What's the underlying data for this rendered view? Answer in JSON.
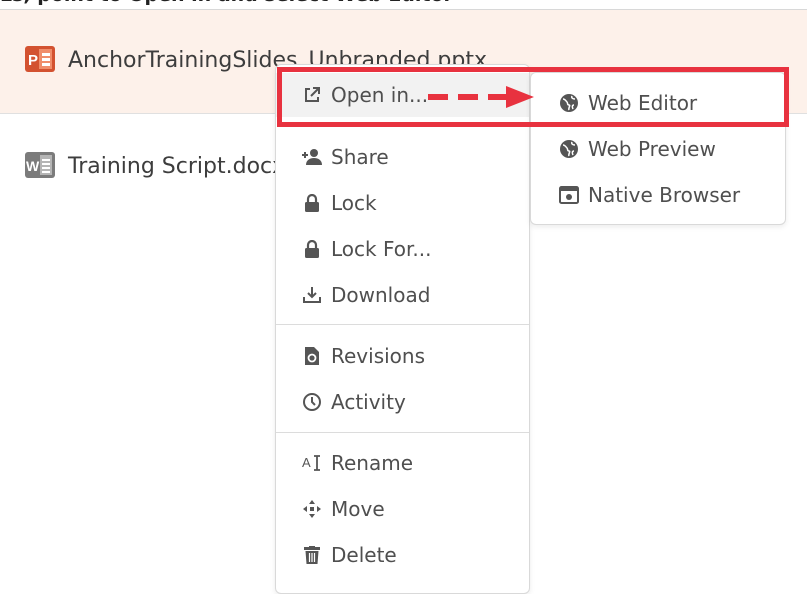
{
  "caption": "Ls, point to Open in and select Web Editor",
  "files": [
    {
      "name": "AnchorTrainingSlides_Unbranded.pptx",
      "icon": "powerpoint-icon",
      "icon_color": "#d35230",
      "selected": true
    },
    {
      "name": "Training Script.docx",
      "icon": "word-icon",
      "icon_color": "#7b7b7b",
      "selected": false
    }
  ],
  "context_menu": {
    "open_in": {
      "label": "Open in...",
      "icon": "external-link-icon"
    },
    "share": {
      "label": "Share",
      "icon": "add-user-icon"
    },
    "lock": {
      "label": "Lock",
      "icon": "lock-icon"
    },
    "lock_for": {
      "label": "Lock For...",
      "icon": "lock-icon"
    },
    "download": {
      "label": "Download",
      "icon": "download-icon"
    },
    "revisions": {
      "label": "Revisions",
      "icon": "file-revision-icon"
    },
    "activity": {
      "label": "Activity",
      "icon": "clock-icon"
    },
    "rename": {
      "label": "Rename",
      "icon": "rename-icon"
    },
    "move": {
      "label": "Move",
      "icon": "move-arrows-icon"
    },
    "delete": {
      "label": "Delete",
      "icon": "trash-icon"
    }
  },
  "submenu": {
    "web_editor": {
      "label": "Web Editor",
      "icon": "globe-icon"
    },
    "web_preview": {
      "label": "Web Preview",
      "icon": "globe-icon"
    },
    "native_browser": {
      "label": "Native Browser",
      "icon": "browser-window-icon"
    }
  },
  "colors": {
    "highlight": "#e8323f",
    "selected_row_bg": "#fdf1ea",
    "menu_text": "#4f4f4f"
  }
}
